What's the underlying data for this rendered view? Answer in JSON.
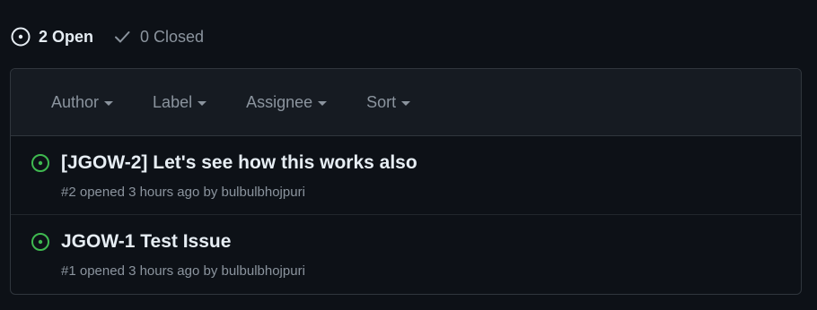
{
  "state_bar": {
    "open_label": "2 Open",
    "closed_label": "0 Closed",
    "open_icon": "issue-opened-icon",
    "closed_icon": "check-icon"
  },
  "filters": {
    "author": "Author",
    "label": "Label",
    "assignee": "Assignee",
    "sort": "Sort"
  },
  "issues": [
    {
      "title": "[JGOW-2] Let's see how this works also",
      "number": "#2",
      "opened": "opened 3 hours ago by",
      "author": "bulbulbhojpuri",
      "icon": "issue-opened-icon"
    },
    {
      "title": "JGOW-1 Test Issue",
      "number": "#1",
      "opened": "opened 3 hours ago by",
      "author": "bulbulbhojpuri",
      "icon": "issue-opened-icon"
    }
  ],
  "colors": {
    "background": "#0d1117",
    "header_bg": "#161b22",
    "border": "#30363d",
    "open_green": "#3fb950",
    "muted_text": "#8b949e",
    "primary_text": "#e6edf3"
  }
}
